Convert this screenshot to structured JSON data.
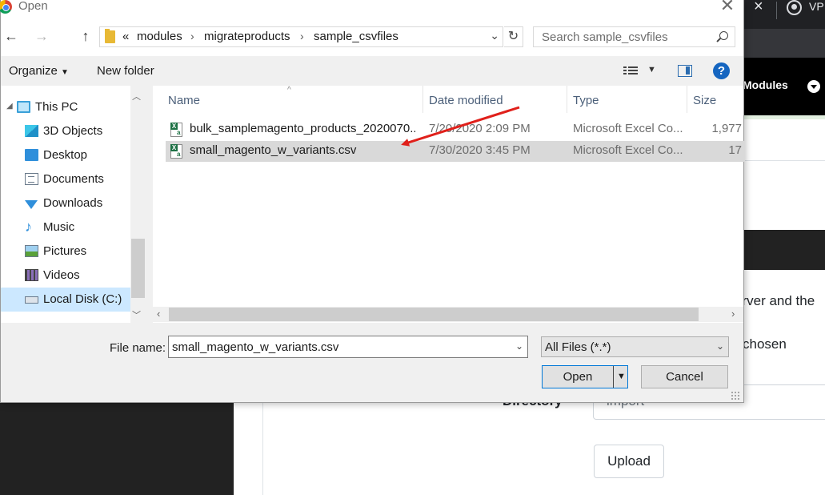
{
  "browser_bg": {
    "vpn_label": "VP",
    "nav_modules": "Modules",
    "text_line1": "erver and the",
    "text_line2": "chosen",
    "directory_label": "Directory",
    "directory_value": "import",
    "upload_button": "Upload"
  },
  "dialog": {
    "title": "Open",
    "address": {
      "overflow": "«",
      "crumbs": [
        "modules",
        "migrateproducts",
        "sample_csvfiles"
      ]
    },
    "search": {
      "placeholder": "Search sample_csvfiles"
    },
    "toolbar": {
      "organize": "Organize",
      "new_folder": "New folder",
      "help": "?"
    },
    "sidebar": {
      "items": [
        {
          "label": "This PC",
          "icon": "this-pc-icon"
        },
        {
          "label": "3D Objects",
          "icon": "3d-objects-icon"
        },
        {
          "label": "Desktop",
          "icon": "desktop-icon"
        },
        {
          "label": "Documents",
          "icon": "documents-icon"
        },
        {
          "label": "Downloads",
          "icon": "downloads-icon"
        },
        {
          "label": "Music",
          "icon": "music-icon"
        },
        {
          "label": "Pictures",
          "icon": "pictures-icon"
        },
        {
          "label": "Videos",
          "icon": "videos-icon"
        },
        {
          "label": "Local Disk (C:)",
          "icon": "local-disk-icon",
          "selected": true
        }
      ]
    },
    "columns": [
      "Name",
      "Date modified",
      "Type",
      "Size"
    ],
    "files": [
      {
        "name": "bulk_samplemagento_products_2020070...",
        "date": "7/20/2020 2:09 PM",
        "type": "Microsoft Excel Co...",
        "size": "1,977"
      },
      {
        "name": "small_magento_w_variants.csv",
        "date": "7/30/2020 3:45 PM",
        "type": "Microsoft Excel Co...",
        "size": "17",
        "selected": true
      }
    ],
    "footer": {
      "file_name_label": "File name:",
      "file_name_value": "small_magento_w_variants.csv",
      "file_type": "All Files (*.*)",
      "open_button": "Open",
      "cancel_button": "Cancel"
    }
  },
  "colors": {
    "arrow": "#e0201b",
    "selection": "#d9d9d9",
    "nav_selection": "#cce8ff",
    "help_blue": "#1565c0"
  }
}
